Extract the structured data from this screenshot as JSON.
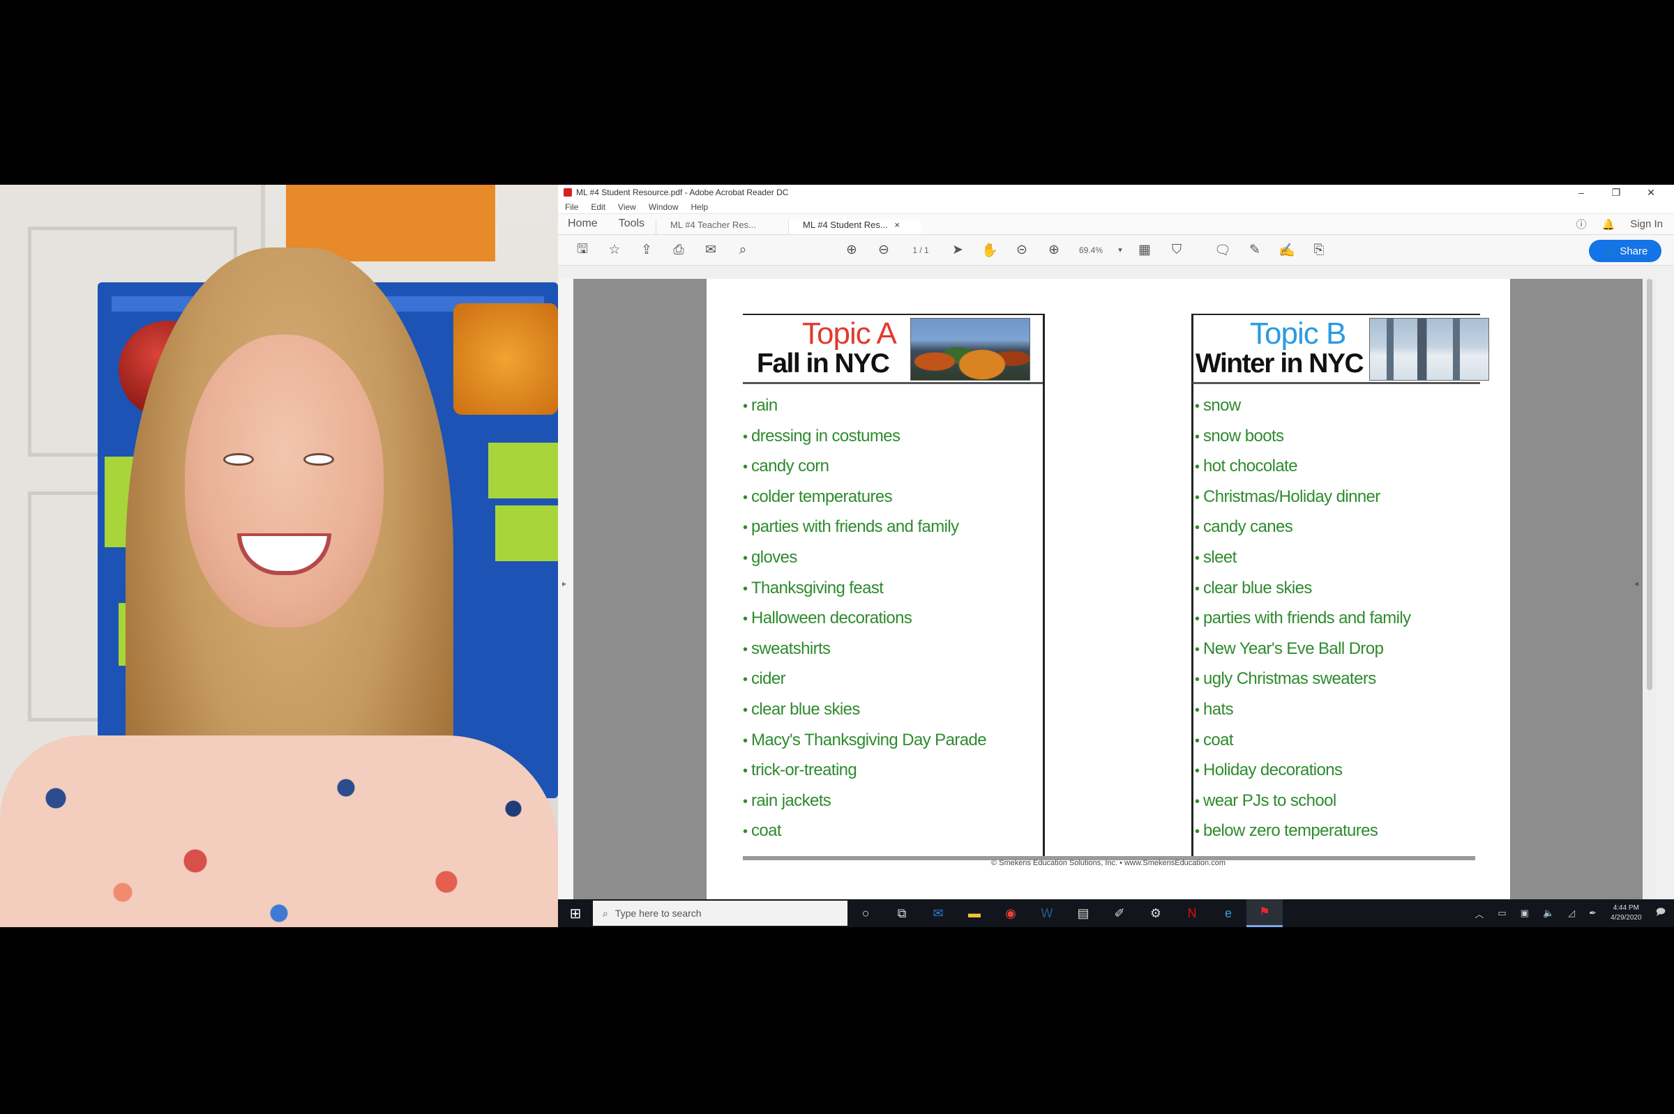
{
  "window": {
    "title": "ML #4 Student Resource.pdf - Adobe Acrobat Reader DC",
    "controls": [
      "–",
      "❐",
      "✕"
    ]
  },
  "menu": [
    "File",
    "Edit",
    "View",
    "Window",
    "Help"
  ],
  "tabs": {
    "home": "Home",
    "tools": "Tools",
    "doc1": "ML #4 Teacher Res...",
    "doc2": "ML #4 Student Res...",
    "doc2_close": "×",
    "sign_in": "Sign In"
  },
  "toolbar": {
    "page_indicator": "1 / 1",
    "zoom": "69.4%",
    "share": "Share"
  },
  "chart_doc": {
    "topic_a": {
      "label": "Topic A",
      "title": "Fall in NYC",
      "color": "#e03a2e"
    },
    "topic_b": {
      "label": "Topic B",
      "title": "Winter in NYC",
      "color": "#2a9be0"
    },
    "fall_items": [
      "rain",
      "dressing in costumes",
      "candy corn",
      "colder temperatures",
      "parties with friends and family",
      "gloves",
      "Thanksgiving feast",
      "Halloween decorations",
      "sweatshirts",
      "cider",
      "clear blue skies",
      "Macy's Thanksgiving Day Parade",
      "trick-or-treating",
      "rain jackets",
      "coat"
    ],
    "winter_items": [
      "snow",
      "snow boots",
      "hot chocolate",
      "Christmas/Holiday dinner",
      "candy canes",
      "sleet",
      "clear blue skies",
      "parties with friends and family",
      "New Year's Eve Ball Drop",
      "ugly Christmas sweaters",
      "hats",
      "coat",
      "Holiday decorations",
      "wear PJs to school",
      "below zero temperatures"
    ],
    "bullet": "•",
    "footer": "© Smekens Education Solutions, Inc. • www.SmekensEducation.com"
  },
  "taskbar": {
    "search_placeholder": "Type here to search",
    "clock_time": "4:44 PM",
    "clock_date": "4/29/2020"
  }
}
